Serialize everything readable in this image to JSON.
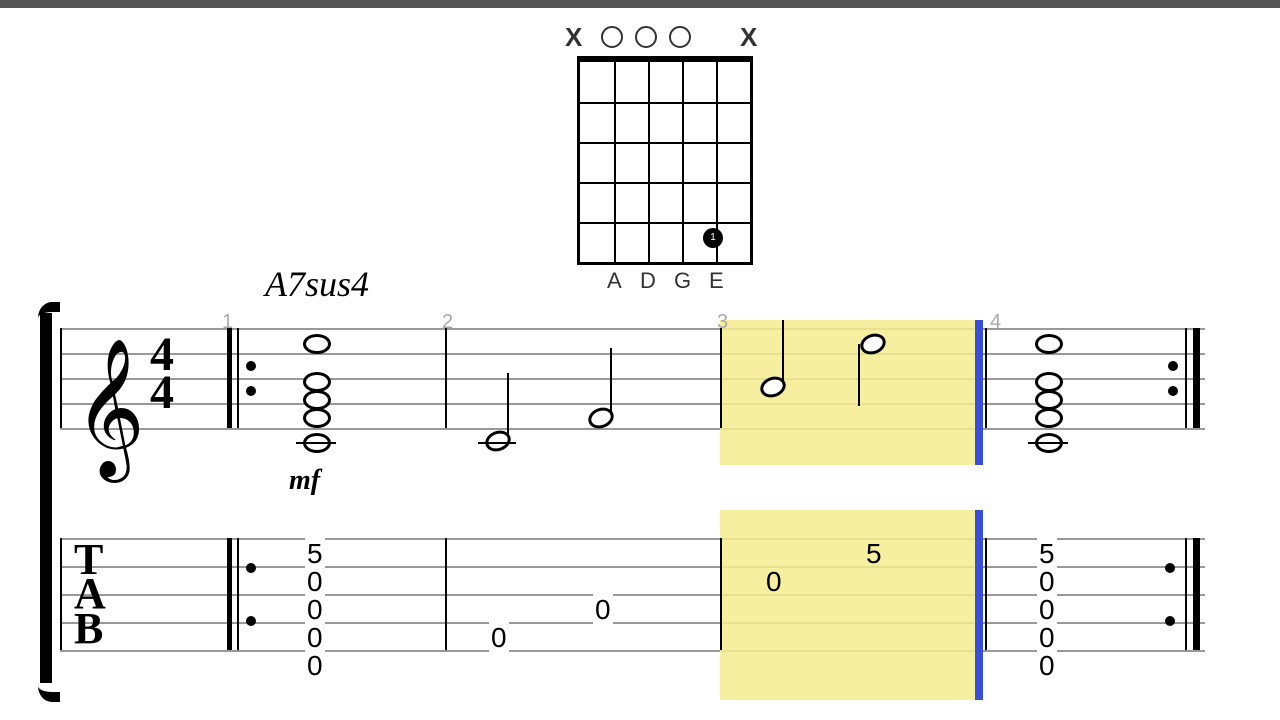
{
  "chord": {
    "name": "A7sus4",
    "open_strings_labels": [
      "A",
      "D",
      "G",
      "E"
    ],
    "markers_top": [
      "X",
      "O",
      "O",
      "O",
      "",
      "X"
    ],
    "fingered": [
      {
        "string": 5,
        "fret": 5,
        "finger": "1"
      }
    ]
  },
  "time_sig": {
    "num": "4",
    "den": "4"
  },
  "bar_numbers": [
    "1",
    "2",
    "3",
    "4"
  ],
  "dynamic": "mf",
  "playhead_bar": 3,
  "notation_bars": [
    {
      "bar": 1,
      "type": "chord-whole",
      "stack": [
        "e5",
        "d5",
        "a4",
        "g4",
        "e4"
      ]
    },
    {
      "bar": 2,
      "type": "halves",
      "notes": [
        "a3",
        "d4"
      ]
    },
    {
      "bar": 3,
      "type": "halves",
      "notes": [
        "g4",
        "e5"
      ]
    },
    {
      "bar": 4,
      "type": "chord-whole",
      "stack": [
        "e5",
        "d5",
        "a4",
        "g4",
        "e4"
      ]
    }
  ],
  "tab": {
    "label_letters": [
      "T",
      "A",
      "B"
    ],
    "bars": [
      {
        "bar": 1,
        "columns": [
          {
            "x": 0,
            "frets": [
              "5",
              "0",
              "0",
              "0",
              "0"
            ]
          }
        ]
      },
      {
        "bar": 2,
        "columns": [
          {
            "x": 0,
            "frets": [
              "",
              "",
              "",
              "0",
              ""
            ]
          },
          {
            "x": 1,
            "frets": [
              "",
              "",
              "0",
              "",
              ""
            ]
          }
        ]
      },
      {
        "bar": 3,
        "columns": [
          {
            "x": 0,
            "frets": [
              "",
              "0",
              "",
              "",
              ""
            ]
          },
          {
            "x": 1,
            "frets": [
              "5",
              "",
              "",
              "",
              ""
            ]
          }
        ]
      },
      {
        "bar": 4,
        "columns": [
          {
            "x": 0,
            "frets": [
              "5",
              "0",
              "0",
              "0",
              "0"
            ]
          }
        ]
      }
    ]
  }
}
